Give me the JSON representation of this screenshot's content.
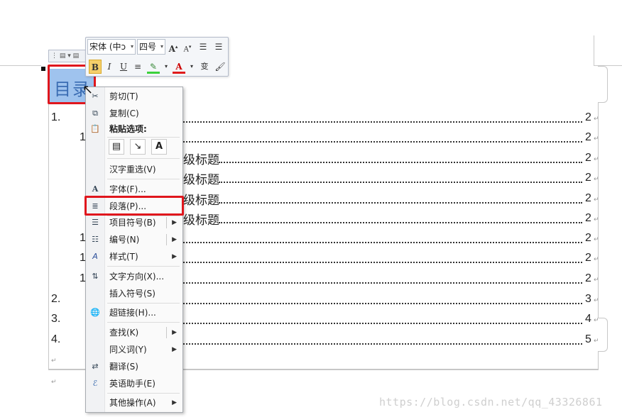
{
  "mini_toolbar": {
    "font_name": "宋体 (中ɔ",
    "font_size": "四号",
    "grow_font": "A",
    "shrink_font": "A",
    "bold": "B",
    "italic": "I",
    "underline": "U",
    "font_color_label": "A",
    "phonetic": "变"
  },
  "document": {
    "title": "目录",
    "toc": [
      {
        "num": "1.",
        "text": "",
        "page": "2"
      },
      {
        "num": "1",
        "text": "",
        "page": "2"
      },
      {
        "num": "",
        "text": "级标题",
        "page": "2"
      },
      {
        "num": "",
        "text": "级标题",
        "page": "2"
      },
      {
        "num": "",
        "text": "级标题",
        "page": "2"
      },
      {
        "num": "",
        "text": "级标题",
        "page": "2"
      },
      {
        "num": "1",
        "text": "",
        "page": "2"
      },
      {
        "num": "1",
        "text": "",
        "page": "2"
      },
      {
        "num": "1",
        "text": "",
        "page": "2"
      },
      {
        "num": "2.",
        "text": "",
        "page": "3"
      },
      {
        "num": "3.",
        "text": "",
        "page": "4"
      },
      {
        "num": "4.",
        "text": "",
        "page": "5"
      }
    ],
    "para_mark": "↵"
  },
  "context_menu": {
    "cut": "剪切(T)",
    "copy": "复制(C)",
    "paste_options": "粘贴选项:",
    "hanzi_reselect": "汉字重选(V)",
    "font": "字体(F)...",
    "paragraph": "段落(P)...",
    "bullets": "项目符号(B)",
    "numbering": "编号(N)",
    "styles": "样式(T)",
    "text_direction": "文字方向(X)...",
    "insert_symbol": "插入符号(S)",
    "hyperlink": "超链接(H)...",
    "find": "查找(K)",
    "synonyms": "同义词(Y)",
    "translate": "翻译(S)",
    "english_assistant": "英语助手(E)",
    "other_actions": "其他操作(A)"
  },
  "watermark": "https://blog.csdn.net/qq_43326861",
  "colors": {
    "highlight": "#9fc3ee",
    "red_box": "#e0161d",
    "bold_button": "#f5cf6a"
  }
}
